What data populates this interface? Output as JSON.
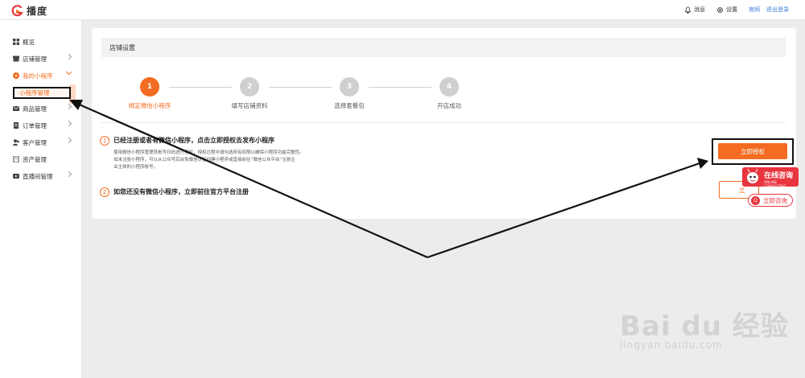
{
  "header": {
    "logo_text": "播度",
    "messages_label": "消息",
    "settings_label": "设置",
    "official_site_link": "官网",
    "logout_link": "退出登录"
  },
  "sidebar": {
    "items": [
      {
        "label": "概览",
        "icon": "grid-icon"
      },
      {
        "label": "店铺管理",
        "icon": "store-icon"
      },
      {
        "label": "我的小程序",
        "icon": "miniprogram-icon"
      },
      {
        "label": "商品管理",
        "icon": "goods-icon"
      },
      {
        "label": "订单管理",
        "icon": "order-icon"
      },
      {
        "label": "客户管理",
        "icon": "customer-icon"
      },
      {
        "label": "资产管理",
        "icon": "asset-icon"
      },
      {
        "label": "直播间管理",
        "icon": "live-icon"
      }
    ],
    "sub_item": "小程序管理"
  },
  "panel": {
    "title": "店铺设置"
  },
  "steps": [
    {
      "number": "1",
      "label": "绑定微信小程序",
      "active": true
    },
    {
      "number": "2",
      "label": "填写店铺资料",
      "active": false
    },
    {
      "number": "3",
      "label": "选择套餐包",
      "active": false
    },
    {
      "number": "4",
      "label": "开店成功",
      "active": false
    }
  ],
  "options": {
    "option1": {
      "number": "1",
      "title": "已经注册或者有微信小程序，点击立即授权去发布小程序",
      "desc_line1": "使用微信小程序管理员帐号扫码进行授权，授权过程中请勾选所有权限以确保小程序功能完整性。",
      "desc_line2": "如未注册小程序，可以从公众号后台免微信认证创建小程序或直接前往“微信公众平台”注册企",
      "desc_line3": "业主体的小程序帐号。",
      "button": "立即授权"
    },
    "option2": {
      "number": "2",
      "title": "如您还没有微信小程序，立即前往官方平台注册",
      "button": "立"
    }
  },
  "consult": {
    "title": "在线咨询",
    "subtitle": "ONLINE CONSULTING",
    "button": "立即咨询",
    "badge": "Q"
  },
  "watermark": {
    "main": "Bai du 经验",
    "url": "jingyan.baidu.com"
  },
  "colors": {
    "accent": "#f36c21",
    "link": "#3b7ed8",
    "consult_red": "#e8353f"
  }
}
